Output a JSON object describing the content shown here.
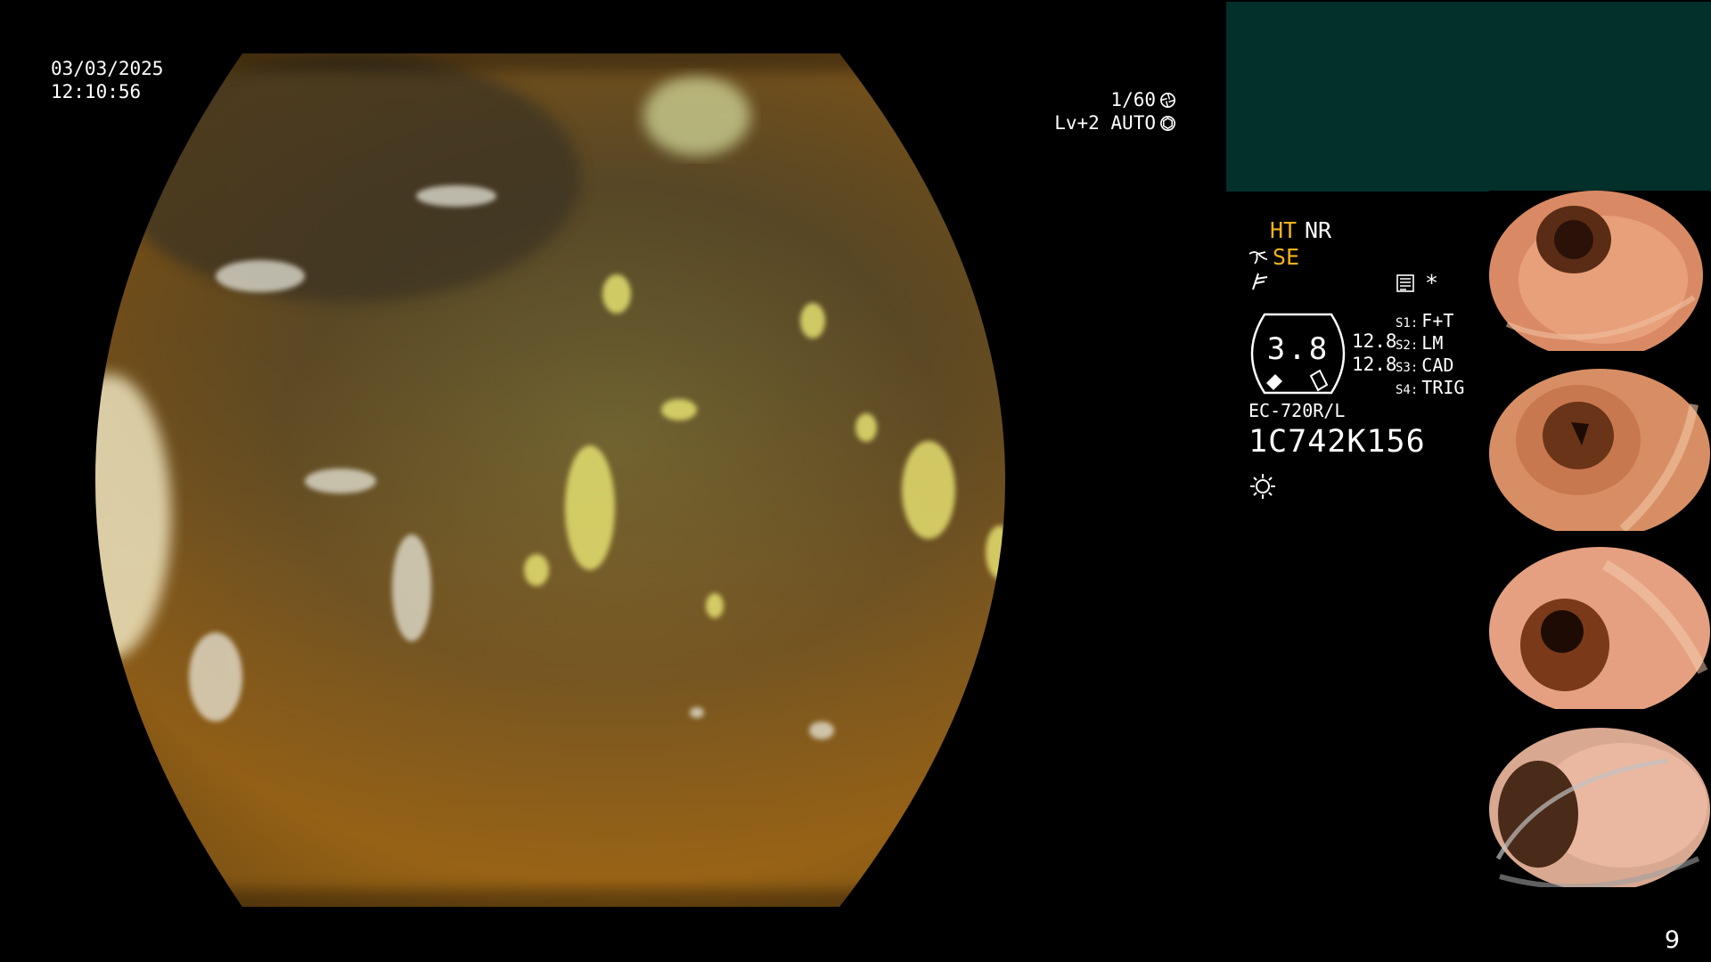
{
  "osd": {
    "date": "03/03/2025",
    "time": "12:10:56",
    "shutter": "1/60",
    "iris": "Lv+2 AUTO"
  },
  "status": {
    "ht": "HT",
    "nr": "NR",
    "se": "SE",
    "gauge_value": "3.8",
    "side_values": [
      "12.8",
      "12.8"
    ],
    "modes": [
      {
        "key": "S1:",
        "value": "F+T"
      },
      {
        "key": "S2:",
        "value": "LM"
      },
      {
        "key": "S3:",
        "value": "CAD"
      },
      {
        "key": "S4:",
        "value": "TRIG"
      }
    ],
    "asterisk": "*",
    "scope_model": "EC-720R/L",
    "serial": "1C742K156"
  },
  "colors": {
    "highlight": "#f2b31b",
    "panel": "#03302a",
    "background": "#000000"
  },
  "icons": [
    "shutter-icon",
    "iris-icon",
    "hose-icon",
    "flag-icon",
    "memo-icon",
    "light-icon"
  ],
  "page_number": "9"
}
